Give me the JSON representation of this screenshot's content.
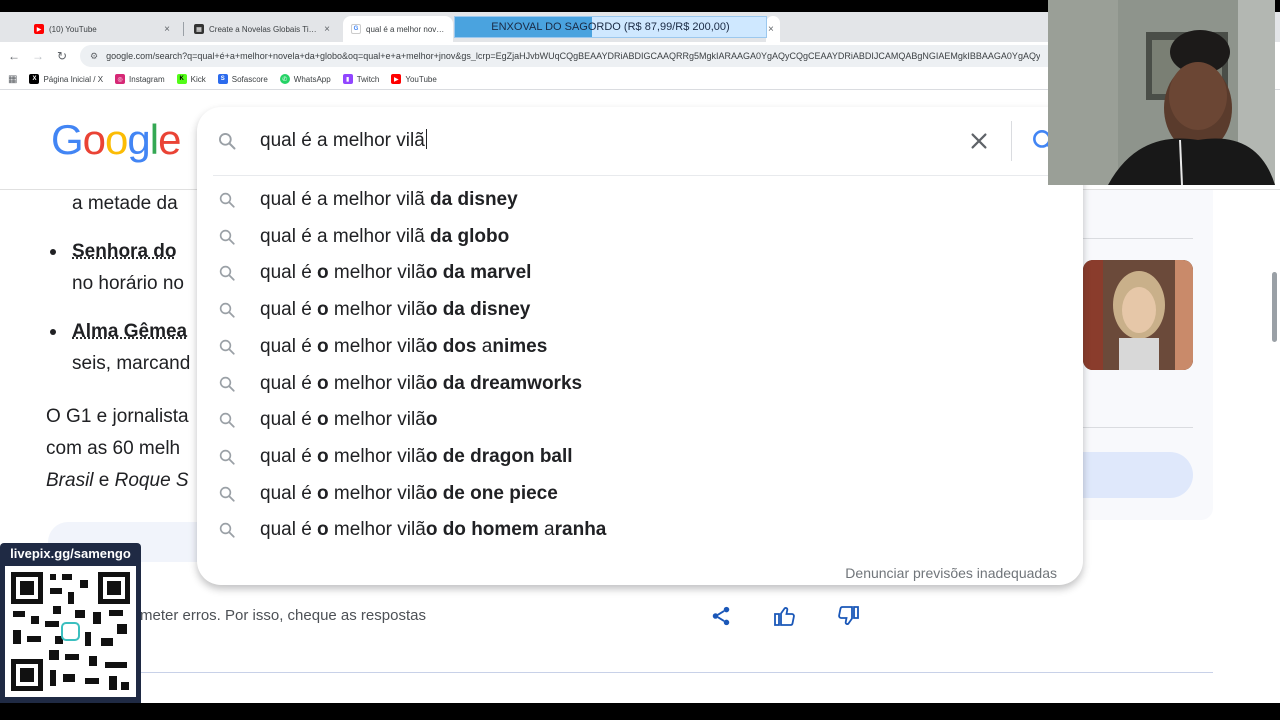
{
  "tabs": [
    {
      "title": "(10) YouTube",
      "favicon": "youtube-icon"
    },
    {
      "title": "Create a Novelas Globais Tier List",
      "favicon": "tiermaker-icon"
    },
    {
      "title": "qual é a melhor novela da globo",
      "favicon": "google-icon"
    }
  ],
  "overlay_banner": {
    "text": "ENXOVAL DO SAGORDO (R$ 87,99/R$ 200,00)",
    "progress": 0.44
  },
  "address_bar": {
    "url": "google.com/search?q=qual+é+a+melhor+novela+da+globo&oq=qual+e+a+melhor+jnov&gs_lcrp=EgZjaHJvbWUqCQgBEAAYDRiABDIGCAAQRRg5MgkIARAAGA0YgAQyCQgCEAAYDRiABDIJCAMQABgNGIAEMgkIBBAAGA0YgAQy"
  },
  "bookmarks": [
    {
      "label": "Página Inicial / X",
      "icon": "x-icon"
    },
    {
      "label": "Instagram",
      "icon": "instagram-icon"
    },
    {
      "label": "Kick",
      "icon": "kick-icon"
    },
    {
      "label": "Sofascore",
      "icon": "sofascore-icon"
    },
    {
      "label": "WhatsApp",
      "icon": "whatsapp-icon"
    },
    {
      "label": "Twitch",
      "icon": "twitch-icon"
    },
    {
      "label": "YouTube",
      "icon": "youtube-icon"
    }
  ],
  "logo": {
    "letters": [
      "G",
      "o",
      "o",
      "g",
      "l",
      "e"
    ]
  },
  "search": {
    "query": "qual é a melhor vilã"
  },
  "suggestions": [
    {
      "parts": [
        {
          "t": "qual é a melhor vilã ",
          "b": false
        },
        {
          "t": "da disney",
          "b": true
        }
      ]
    },
    {
      "parts": [
        {
          "t": "qual é a melhor vilã ",
          "b": false
        },
        {
          "t": "da globo",
          "b": true
        }
      ]
    },
    {
      "parts": [
        {
          "t": "qual é ",
          "b": false
        },
        {
          "t": "o",
          "b": true
        },
        {
          "t": " melhor vilã",
          "b": false
        },
        {
          "t": "o da marvel",
          "b": true
        }
      ]
    },
    {
      "parts": [
        {
          "t": "qual é ",
          "b": false
        },
        {
          "t": "o",
          "b": true
        },
        {
          "t": " melhor vilã",
          "b": false
        },
        {
          "t": "o da disney",
          "b": true
        }
      ]
    },
    {
      "parts": [
        {
          "t": "qual é ",
          "b": false
        },
        {
          "t": "o",
          "b": true
        },
        {
          "t": " melhor vilã",
          "b": false
        },
        {
          "t": "o dos ",
          "b": true
        },
        {
          "t": "a",
          "b": false
        },
        {
          "t": "nimes",
          "b": true
        }
      ]
    },
    {
      "parts": [
        {
          "t": "qual é ",
          "b": false
        },
        {
          "t": "o",
          "b": true
        },
        {
          "t": " melhor vilã",
          "b": false
        },
        {
          "t": "o da dreamworks",
          "b": true
        }
      ]
    },
    {
      "parts": [
        {
          "t": "qual é ",
          "b": false
        },
        {
          "t": "o",
          "b": true
        },
        {
          "t": " melhor vilã",
          "b": false
        },
        {
          "t": "o",
          "b": true
        }
      ]
    },
    {
      "parts": [
        {
          "t": "qual é ",
          "b": false
        },
        {
          "t": "o",
          "b": true
        },
        {
          "t": " melhor vilã",
          "b": false
        },
        {
          "t": "o de dragon ball",
          "b": true
        }
      ]
    },
    {
      "parts": [
        {
          "t": "qual é ",
          "b": false
        },
        {
          "t": "o",
          "b": true
        },
        {
          "t": " melhor vilã",
          "b": false
        },
        {
          "t": "o de one piece",
          "b": true
        }
      ]
    },
    {
      "parts": [
        {
          "t": "qual é ",
          "b": false
        },
        {
          "t": "o",
          "b": true
        },
        {
          "t": " melhor vilã",
          "b": false
        },
        {
          "t": "o do homem ",
          "b": true
        },
        {
          "t": "a",
          "b": false
        },
        {
          "t": "ranha",
          "b": true
        }
      ]
    }
  ],
  "report_link": "Denunciar previsões inadequadas",
  "page_text": {
    "line_metade": "a metade da",
    "bullet1_title": "Senhora do",
    "bullet1_cont": "no horário no",
    "bullet2_title": "Alma Gêmea",
    "bullet2_cont": "seis, marcand",
    "para_1": "O G1 e jornalista",
    "para_2": "com as 60 melh",
    "para_3_a": "Brasil",
    "para_3_b": " e ",
    "para_3_c": "Roque S"
  },
  "ai_notice": "meter erros. Por isso, cheque as respostas",
  "qr": {
    "label": "livepix.gg/samengo"
  },
  "colors": {
    "google_blue": "#4285F4",
    "google_red": "#EA4335",
    "google_yellow": "#FBBC05",
    "google_green": "#34A853",
    "banner_fill": "#4aa3df",
    "qr_card": "#1f2a44"
  }
}
